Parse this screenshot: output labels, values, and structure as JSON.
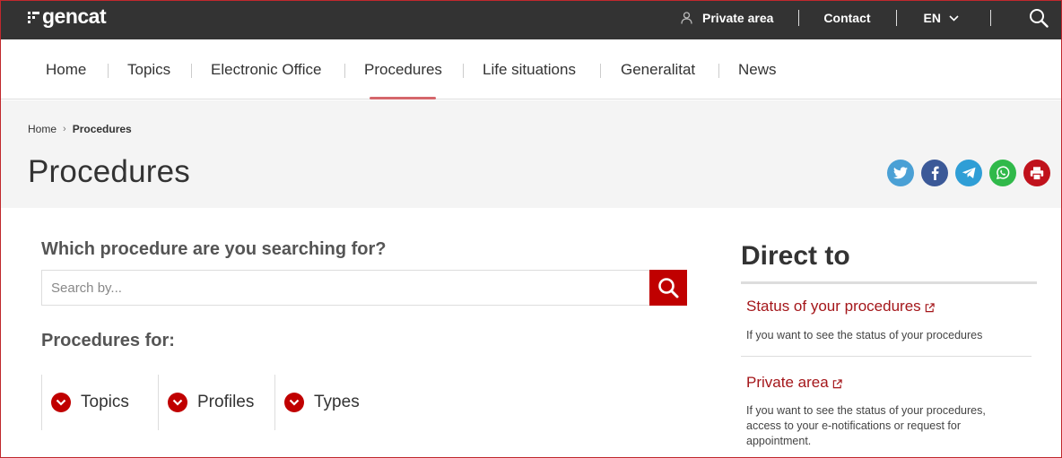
{
  "header": {
    "logo": "gencat",
    "private_area": "Private area",
    "contact": "Contact",
    "language": "EN"
  },
  "nav": {
    "items": [
      "Home",
      "Topics",
      "Electronic Office",
      "Procedures",
      "Life situations",
      "Generalitat",
      "News"
    ],
    "active": "Procedures"
  },
  "breadcrumb": [
    "Home",
    "Procedures"
  ],
  "page": {
    "title": "Procedures"
  },
  "share": [
    "twitter",
    "facebook",
    "telegram",
    "whatsapp",
    "print"
  ],
  "search": {
    "heading": "Which procedure are you searching for?",
    "placeholder": "Search by...",
    "value": ""
  },
  "procedures_for": {
    "heading": "Procedures for:",
    "filters": [
      "Topics",
      "Profiles",
      "Types"
    ]
  },
  "direct_to": {
    "title": "Direct to",
    "items": [
      {
        "title": "Status of your procedures",
        "description": "If you want to see the status of your procedures"
      },
      {
        "title": "Private area",
        "description": "If you want to see the status of your procedures, access to your e-notifications or request for appointment."
      }
    ]
  },
  "colors": {
    "topbar": "#333333",
    "accent": "#c00000",
    "link": "#a4161a",
    "twitter": "#4aa0d5",
    "facebook": "#3b5998",
    "telegram": "#2f9ed6",
    "whatsapp": "#30b94a",
    "print": "#c0121c"
  },
  "icons": {
    "user": "user-icon",
    "search": "search-icon",
    "chevron": "chevron-down-icon",
    "external": "external-link-icon"
  }
}
